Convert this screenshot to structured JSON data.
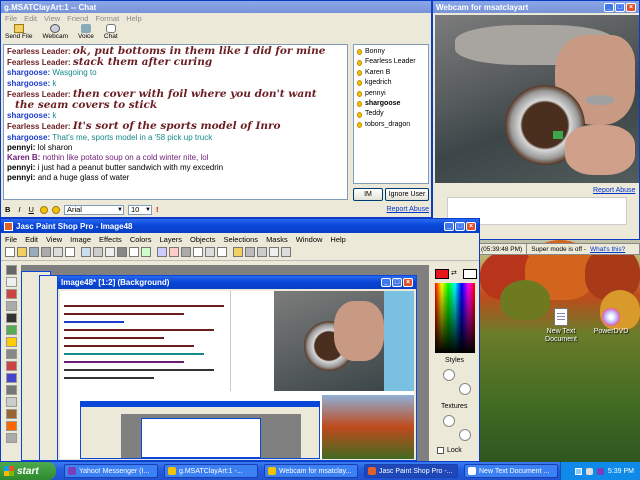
{
  "chat": {
    "title": "g.MSATClayArt:1 -- Chat",
    "menu": [
      "File",
      "Edit",
      "View",
      "Friend",
      "Format",
      "Help"
    ],
    "toolbar": [
      "Send File",
      "Webcam",
      "Voice",
      "Chat"
    ],
    "messages": [
      {
        "name": "Fearless Leader:",
        "text": "ok, put bottoms in them like I did for mine",
        "nc": "c-red",
        "tc": "c-red big"
      },
      {
        "name": "Fearless Leader:",
        "text": "stack them after curing",
        "nc": "c-red",
        "tc": "c-red big"
      },
      {
        "name": "shargoose:",
        "text": "Wasgoing to",
        "nc": "c-blue",
        "tc": "c-teal"
      },
      {
        "name": "shargoose:",
        "text": "k",
        "nc": "c-blue",
        "tc": "c-teal"
      },
      {
        "name": "Fearless Leader:",
        "text": "then cover with foil where you don't want",
        "nc": "c-red",
        "tc": "c-red big"
      },
      {
        "name": "",
        "text": "the seam covers to stick",
        "nc": "c-red",
        "tc": "c-red big",
        "indent": true
      },
      {
        "name": "shargoose:",
        "text": "k",
        "nc": "c-blue",
        "tc": "c-teal"
      },
      {
        "name": "Fearless Leader:",
        "text": "It's sort of the sports model of Inro",
        "nc": "c-red",
        "tc": "c-red big"
      },
      {
        "name": "shargoose:",
        "text": "That's me, sports model in a '58 pick up truck",
        "nc": "c-blue",
        "tc": "c-teal"
      },
      {
        "name": "pennyi:",
        "text": "lol sharon",
        "nc": "c-black",
        "tc": "c-black"
      },
      {
        "name": "Karen B:",
        "text": "nothin like potato soup on a cold winter nite, lol",
        "nc": "c-purple",
        "tc": "c-purple"
      },
      {
        "name": "pennyi:",
        "text": "i just had a peanut butter sandwich with my excedrin",
        "nc": "c-black",
        "tc": "c-black"
      },
      {
        "name": "pennyi:",
        "text": "and a huge glass of water",
        "nc": "c-black",
        "tc": "c-black"
      }
    ],
    "buddies": [
      "Bonny",
      "Fearless Leader",
      "Karen B",
      "kgedrich",
      "pennyi",
      "shargoose",
      "Teddy",
      "tobors_dragon"
    ],
    "bold_buddy": "shargoose",
    "im_label": "IM",
    "ignore_label": "Ignore User",
    "format_bar": {
      "bold": "B",
      "italic": "I",
      "underline": "U",
      "font": "Arial",
      "size": "10"
    },
    "report_abuse": "Report Abuse"
  },
  "webcam": {
    "title": "Webcam for msatclayart",
    "report_abuse": "Report Abuse"
  },
  "status": {
    "time": "(05:39:48 PM)",
    "super_mode": "Super mode is off -",
    "whats_this": "What's this?"
  },
  "psp": {
    "title": "Jasc Paint Shop Pro - Image48",
    "menu": [
      "File",
      "Edit",
      "View",
      "Image",
      "Effects",
      "Colors",
      "Layers",
      "Objects",
      "Selections",
      "Masks",
      "Window",
      "Help"
    ],
    "image_title": "Image48* [1:2] (Background)",
    "styles_label": "Styles",
    "textures_label": "Textures",
    "lock_label": "Lock"
  },
  "desktop_icons": [
    {
      "label": "New Text Document"
    },
    {
      "label": "PowerDVD"
    }
  ],
  "taskbar": {
    "start": "start",
    "items": [
      {
        "label": "Yahoo! Messenger (I...",
        "color": "#7a3fb8"
      },
      {
        "label": "g.MSATClayArt:1 -...",
        "color": "#f2c400"
      },
      {
        "label": "Webcam for msatclay...",
        "color": "#f2c400"
      },
      {
        "label": "Jasc Paint Shop Pro -...",
        "color": "#e0602a"
      },
      {
        "label": "New Text Document ...",
        "color": "#ffffff"
      }
    ],
    "clock": "5:39 PM"
  }
}
